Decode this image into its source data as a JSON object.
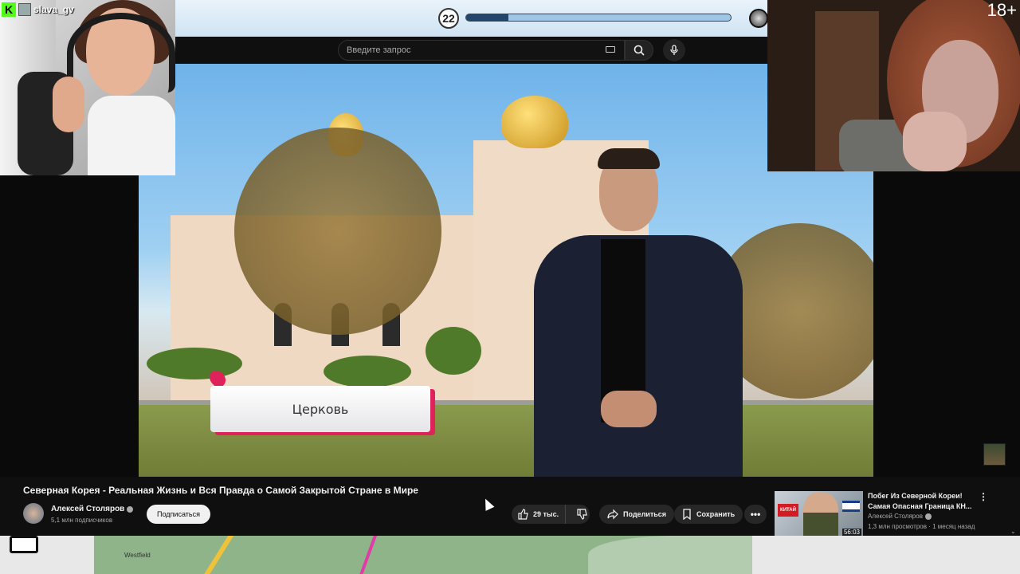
{
  "stream": {
    "level": "22",
    "level_progress": 0.16,
    "streamer_name": "slava_gv",
    "age_rating": "18+"
  },
  "youtube": {
    "search": {
      "placeholder": "Введите запрос",
      "icons": [
        "keyboard-icon",
        "search-icon",
        "mic-icon"
      ]
    },
    "video": {
      "overlay_label": "Церковь",
      "title": "Северная Корея - Реальная Жизнь и Вся Правда о Самой Закрытой Стране в Мире",
      "channel": "Алексей Столяров",
      "subscribers": "5,1 млн подписчиков",
      "subscribe_label": "Подписаться",
      "likes": "29 тыс.",
      "share_label": "Поделиться",
      "save_label": "Сохранить"
    },
    "recommended": {
      "title_line1": "Побег Из Северной Кореи!",
      "title_line2": "Самая Опасная Граница КН...",
      "channel": "Алексей Столяров",
      "meta": "1,3 млн просмотров · 1 месяц назад",
      "duration": "56:03",
      "thumb_text": "КИТАЙ"
    }
  },
  "map": {
    "label": "Westfield"
  },
  "colors": {
    "accent_pink": "#e0225c",
    "kick_green": "#53fc18",
    "yt_bg": "#0f0f0f"
  }
}
